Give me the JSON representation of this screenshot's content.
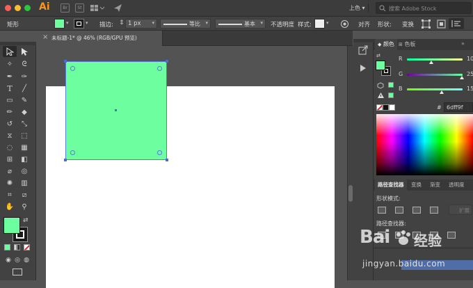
{
  "app": {
    "logo": "Ai",
    "br_icon": "Br",
    "st_icon": "St"
  },
  "workspace": {
    "label": "上色",
    "dropdown": "▾"
  },
  "stock_search": {
    "placeholder": "搜索 Adobe Stock"
  },
  "control": {
    "object_type": "矩形",
    "stroke_label": "描边:",
    "stroke_weight": "1 px",
    "profile_label": "等比",
    "brush_label": "基本",
    "opacity_label": "不透明度",
    "style_label": "样式:",
    "align_label": "对齐",
    "shape_label": "形状:",
    "transform_label": "变换",
    "fill_color": "#6dff9f"
  },
  "document": {
    "tab_title": "未标题-1* @ 46% (RGB/GPU 预览)",
    "close": "×"
  },
  "panels": {
    "tab_color": "颜色",
    "tab_swatches": "色板",
    "r_label": "R",
    "g_label": "G",
    "b_label": "B",
    "r_value": "10",
    "g_value": "25",
    "b_value": "15",
    "hex_prefix": "#",
    "hex_value": "6dff9f",
    "tab_pathfinder": "路径查找器",
    "tab_transform": "变换",
    "tab_gradient": "渐变",
    "tab_transparency": "透明度",
    "shape_modes": "形状模式:",
    "expand": "扩展",
    "pathfinders": "路径查找器:"
  },
  "watermark": {
    "line1": "Bai",
    "line2": "经验",
    "url": "jingyan.baidu.com"
  },
  "colors": {
    "fill": "#6dff9f",
    "selection": "#4a6bd6"
  }
}
